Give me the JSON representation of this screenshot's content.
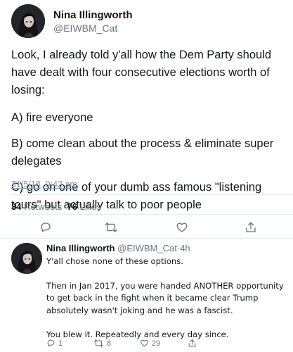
{
  "tweet": {
    "display_name": "Nina Illingworth",
    "handle": "@EIWBM_Cat",
    "paragraphs": [
      "Look, I already told y'all how the Dem Party should have dealt with four consecutive elections worth of losing:",
      "A) fire everyone",
      "B) come clean about the process & eliminate super delegates",
      "C) go on one of your dumb ass famous \"listening tours\" but actually talk to poor people"
    ],
    "timestamp": "31/5/18, 9:42 am",
    "retweets_count": "34",
    "retweets_label": "Retweets",
    "likes_count": "76",
    "likes_label": "Likes"
  },
  "reply": {
    "display_name": "Nina Illingworth",
    "handle": "@EIWBM_Cat",
    "separator": "·",
    "age": "4h",
    "paragraphs": [
      "Y'all chose none of these options.",
      "Then in Jan 2017, you were handed ANOTHER opportunity to get back in the fight when it became clear Trump absolutely wasn't joking and he was a fascist.",
      "You blew it. Repeatedly and every day since."
    ],
    "reply_count": "1",
    "retweet_count": "8",
    "like_count": "29"
  },
  "icons": {
    "reply": "speech-bubble-icon",
    "retweet": "retweet-arrows-icon",
    "like": "heart-icon",
    "share": "share-upload-icon"
  },
  "colors": {
    "text": "#14171a",
    "secondary": "#657786",
    "divider": "#e6ecf0"
  }
}
